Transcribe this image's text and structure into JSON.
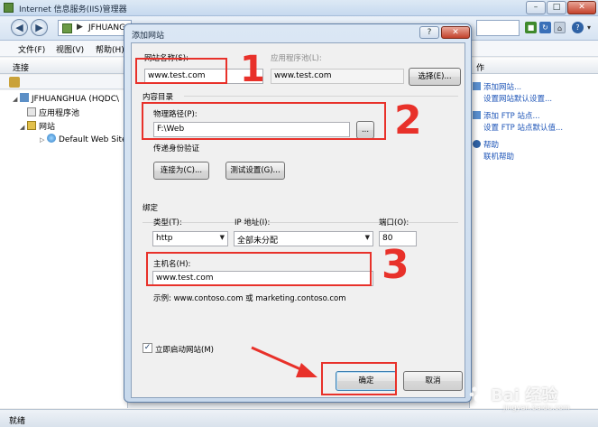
{
  "window": {
    "title": "Internet 信息服务(IIS)管理器",
    "controls": {
      "minimize": "–",
      "maximize": "□",
      "close": "✕"
    }
  },
  "address_bar": {
    "back": "◀",
    "forward": "▶",
    "separator": "▶",
    "breadcrumb": "JFHUANG"
  },
  "toolbar_icons": [
    "stop-icon",
    "refresh-icon",
    "home-icon",
    "help-icon"
  ],
  "menu": {
    "file": "文件(F)",
    "view": "视图(V)",
    "help": "帮助(H)"
  },
  "connections": {
    "header": "连接",
    "tree": [
      {
        "label": "JFHUANGHUA (HQDC\\",
        "toggle": "◢"
      },
      {
        "label": "应用程序池",
        "toggle": ""
      },
      {
        "label": "网站",
        "toggle": "◢"
      },
      {
        "label": "Default Web Site",
        "toggle": "▷"
      }
    ]
  },
  "actions": {
    "header": "作",
    "links": [
      "添加网站...",
      "设置网站默认设置...",
      "添加 FTP 站点...",
      "设置 FTP 站点默认值...",
      "帮助",
      "联机帮助"
    ]
  },
  "status": {
    "text": "就绪"
  },
  "dialog": {
    "title": "添加网站",
    "help": "?",
    "close": "✕",
    "site_name": {
      "label": "网站名称(S):",
      "value": "www.test.com"
    },
    "app_pool": {
      "label": "应用程序池(L):",
      "value": "www.test.com",
      "select_button": "选择(E)..."
    },
    "content_dir": {
      "label": "内容目录",
      "physical_path_label": "物理路径(P):",
      "physical_path_value": "F:\\Web",
      "browse_button": "...",
      "auth_label": "传递身份验证",
      "connect_as_button": "连接为(C)...",
      "test_button": "测试设置(G)..."
    },
    "binding": {
      "label": "绑定",
      "type_label": "类型(T):",
      "type_value": "http",
      "ip_label": "IP 地址(I):",
      "ip_value": "全部未分配",
      "port_label": "端口(O):",
      "port_value": "80",
      "hostname_label": "主机名(H):",
      "hostname_value": "www.test.com",
      "example": "示例: www.contoso.com 或 marketing.contoso.com"
    },
    "start_checkbox": {
      "label": "立即启动网站(M)",
      "checked": true,
      "mark": "✓"
    },
    "ok_button": "确定",
    "cancel_button": "取消"
  },
  "annotations": {
    "num1": "1",
    "num2": "2",
    "num3": "3",
    "color": "#e8312a"
  },
  "watermark": {
    "text": "Bai 经验",
    "sub": "jingyan.baidu.com"
  }
}
